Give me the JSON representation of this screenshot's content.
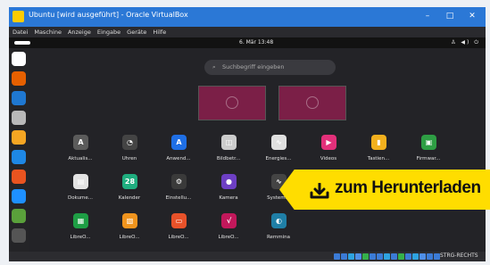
{
  "window": {
    "title": "Ubuntu [wird ausgeführt] - Oracle VirtualBox",
    "controls": [
      "–",
      "□",
      "✕"
    ]
  },
  "menubar": [
    "Datei",
    "Maschine",
    "Anzeige",
    "Eingabe",
    "Geräte",
    "Hilfe"
  ],
  "topbar": {
    "clock": "6. Mär 13:48",
    "system_icons": "♙ ◀) ⏻"
  },
  "search": {
    "placeholder": "Suchbegriff eingeben"
  },
  "dock": [
    {
      "name": "activities",
      "color": "#ffffff"
    },
    {
      "name": "firefox",
      "color": "#e66000"
    },
    {
      "name": "thunderbird",
      "color": "#1f78d1"
    },
    {
      "name": "files",
      "color": "#b9b9b9"
    },
    {
      "name": "rhythmbox",
      "color": "#f5a623"
    },
    {
      "name": "libreoffice-writer",
      "color": "#1e88e5"
    },
    {
      "name": "app-center",
      "color": "#e95420"
    },
    {
      "name": "help",
      "color": "#1e90ff"
    },
    {
      "name": "trash",
      "color": "#5aa13b"
    },
    {
      "name": "show-apps",
      "color": "#555555"
    }
  ],
  "apps": [
    {
      "label": "Aktualis...",
      "color": "#5b5b5b",
      "glyph": "A"
    },
    {
      "label": "Uhren",
      "color": "#444444",
      "glyph": "◔"
    },
    {
      "label": "Anwend...",
      "color": "#1f6fe5",
      "glyph": "A"
    },
    {
      "label": "Bildbetr...",
      "color": "#cccccc",
      "glyph": "◫"
    },
    {
      "label": "Energies...",
      "color": "#e0e0e0",
      "glyph": "∿"
    },
    {
      "label": "Videos",
      "color": "#e3307a",
      "glyph": "▶"
    },
    {
      "label": "Tastien...",
      "color": "#f2b01e",
      "glyph": "▮"
    },
    {
      "label": "Firmwar...",
      "color": "#2e9e44",
      "glyph": "▣"
    },
    {
      "label": "Dokume...",
      "color": "#e3e3e3",
      "glyph": "▤"
    },
    {
      "label": "Kalender",
      "color": "#1fae7f",
      "glyph": "28"
    },
    {
      "label": "Einstellu...",
      "color": "#3a3a3a",
      "glyph": "⚙"
    },
    {
      "label": "Kamera",
      "color": "#6d3fc4",
      "glyph": "●"
    },
    {
      "label": "System...",
      "color": "#444444",
      "glyph": "∿"
    },
    {
      "label": "",
      "color": "#555555",
      "glyph": ""
    },
    {
      "label": "",
      "color": "#444444",
      "glyph": ">_"
    },
    {
      "label": "",
      "color": "#3c3c3c",
      "glyph": "●●"
    },
    {
      "label": "LibreO...",
      "color": "#1e9e45",
      "glyph": "▦"
    },
    {
      "label": "LibreO...",
      "color": "#f0941e",
      "glyph": "▧"
    },
    {
      "label": "LibreO...",
      "color": "#e8522a",
      "glyph": "▭"
    },
    {
      "label": "LibreO...",
      "color": "#c2185b",
      "glyph": "√"
    },
    {
      "label": "Remmina",
      "color": "#1f7fa6",
      "glyph": "◐"
    }
  ],
  "pagination": {
    "total": 2,
    "current": 1
  },
  "statusbar": {
    "hostkey": "STRG-RECHTS"
  },
  "badge": {
    "text": "zum Herunterladen",
    "color": "#ffdd00"
  }
}
